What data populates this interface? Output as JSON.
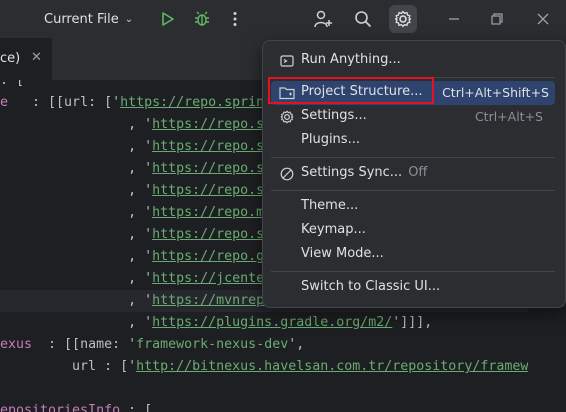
{
  "toolbar": {
    "run_config": "Current File",
    "icons": [
      "run-icon",
      "debug-icon",
      "more-vertical-icon",
      "add-user-icon",
      "search-icon",
      "gear-icon",
      "minimize-icon",
      "restore-icon",
      "close-icon"
    ]
  },
  "tab": {
    "label": "ce)",
    "close": "✕"
  },
  "editor": {
    "lines": [
      {
        "parts": [
          [
            "",
            ": ["
          ]
        ]
      },
      {
        "parts": [
          [
            "k",
            "e"
          ],
          [
            "",
            "   : [[url: ['"
          ],
          [
            "s u",
            "https://repo.sprin"
          ]
        ]
      },
      {
        "parts": [
          [
            "",
            "                , '"
          ],
          [
            "s u",
            "https://repo.spr"
          ]
        ]
      },
      {
        "parts": [
          [
            "",
            "                , '"
          ],
          [
            "s u",
            "https://repo.spr"
          ]
        ]
      },
      {
        "parts": [
          [
            "",
            "                , '"
          ],
          [
            "s u",
            "https://repo.spr"
          ]
        ]
      },
      {
        "parts": [
          [
            "",
            "                , '"
          ],
          [
            "s u",
            "https://repo.spr"
          ]
        ]
      },
      {
        "parts": [
          [
            "",
            "                , '"
          ],
          [
            "s u",
            "https://repo.mav"
          ]
        ]
      },
      {
        "parts": [
          [
            "",
            "                , '"
          ],
          [
            "s u",
            "https://repo.spr"
          ]
        ]
      },
      {
        "parts": [
          [
            "",
            "                , '"
          ],
          [
            "s u",
            "https://repo.gra"
          ]
        ]
      },
      {
        "parts": [
          [
            "",
            "                , '"
          ],
          [
            "s u",
            "https://jcenter."
          ]
        ]
      },
      {
        "parts": [
          [
            "",
            "                , '"
          ],
          [
            "s u",
            "https://mvnrepos"
          ]
        ]
      },
      {
        "parts": [
          [
            "",
            "                , '"
          ],
          [
            "s u",
            "https://plugins.gradle.org/m2/"
          ],
          [
            "",
            "']]],"
          ]
        ]
      },
      {
        "parts": [
          [
            "k",
            "exus"
          ],
          [
            "",
            "  : [[name: '"
          ],
          [
            "s",
            "framework-nexus-dev"
          ],
          [
            "",
            "',"
          ]
        ]
      },
      {
        "parts": [
          [
            "",
            "         url : ['"
          ],
          [
            "s u",
            "http://bitnexus.havelsan.com.tr/repository/framewor"
          ]
        ]
      },
      {
        "parts": [
          [
            "",
            ""
          ]
        ]
      },
      {
        "parts": [
          [
            "k",
            "epositoriesInfo"
          ],
          [
            "",
            " : ["
          ]
        ]
      }
    ]
  },
  "menu": {
    "items": [
      {
        "label": "Run Anything...",
        "shortcut": "",
        "icon": "run-anything-icon"
      },
      {
        "label": "Project Structure...",
        "shortcut": "Ctrl+Alt+Shift+S",
        "icon": "folder-icon"
      },
      {
        "label": "Settings...",
        "shortcut": "Ctrl+Alt+S",
        "icon": "settings-icon"
      },
      {
        "label": "Plugins...",
        "shortcut": "",
        "icon": ""
      },
      {
        "label": "Settings Sync...",
        "suffix": "Off",
        "icon": "sync-off-icon"
      },
      {
        "label": "Theme...",
        "shortcut": "",
        "icon": ""
      },
      {
        "label": "Keymap...",
        "shortcut": "",
        "icon": ""
      },
      {
        "label": "View Mode...",
        "shortcut": "",
        "icon": ""
      },
      {
        "label": "Switch to Classic UI...",
        "shortcut": "",
        "icon": ""
      }
    ]
  },
  "colors": {
    "accent": "#3574f0",
    "selection": "#2e436e",
    "highlight_box": "#e81123",
    "string": "#6aab73",
    "keyword": "#c77dbb"
  }
}
